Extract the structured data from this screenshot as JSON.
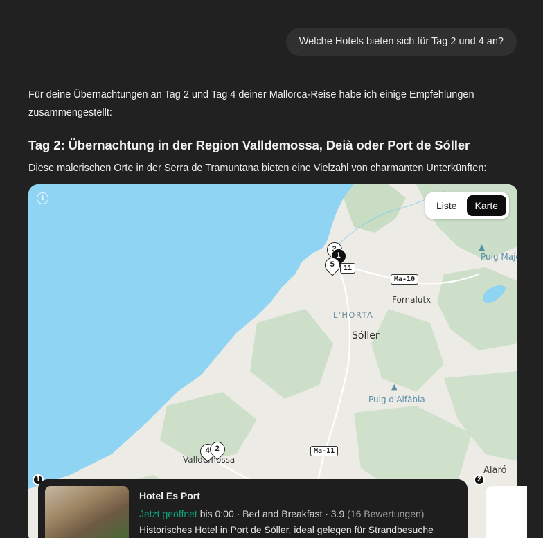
{
  "user_message": "Welche Hotels bieten sich für Tag 2 und 4 an?",
  "answer": {
    "intro": "Für deine Übernachtungen an Tag 2 und Tag 4 deiner Mallorca-Reise habe ich einige Empfehlungen zusammengestellt:",
    "heading": "Tag 2: Übernachtung in der Region Valldemossa, Deià oder Port de Sóller",
    "description": "Diese malerischen Orte in der Serra de Tramuntana bieten eine Vielzahl von charmanten Unterkünften:"
  },
  "map": {
    "info_icon": "info-icon",
    "toggle": {
      "list_label": "Liste",
      "map_label": "Karte",
      "active": "Karte"
    },
    "places": {
      "puig_major": "Puig Major",
      "fornalutx": "Fornalutx",
      "lhorta": "L'HORTA",
      "soller": "Sóller",
      "puig_alfabia": "Puig d'Alfàbia",
      "valldemossa": "Valldemossa",
      "alaro": "Alaró"
    },
    "roads": {
      "ma10": "Ma-10",
      "ma11_top": "11",
      "ma11_bottom": "Ma-11"
    },
    "pins": [
      {
        "label": "1",
        "style": "dark"
      },
      {
        "label": "3",
        "style": "light"
      },
      {
        "label": "5",
        "style": "light"
      },
      {
        "label": "4",
        "style": "light"
      },
      {
        "label": "2",
        "style": "light"
      }
    ],
    "colors": {
      "water": "#8fd4f2",
      "land": "#ecebe6",
      "forest": "#c5dcc1"
    }
  },
  "cards": [
    {
      "number": "1",
      "title": "Hotel Es Port",
      "status": "Jetzt geöffnet",
      "hours": " bis 0:00 · Bed and Breakfast · 3.9 ",
      "reviews": "(16 Bewertungen)",
      "description": "Historisches Hotel in Port de Sóller, ideal gelegen für Strandbesuche"
    },
    {
      "number": "2"
    }
  ]
}
